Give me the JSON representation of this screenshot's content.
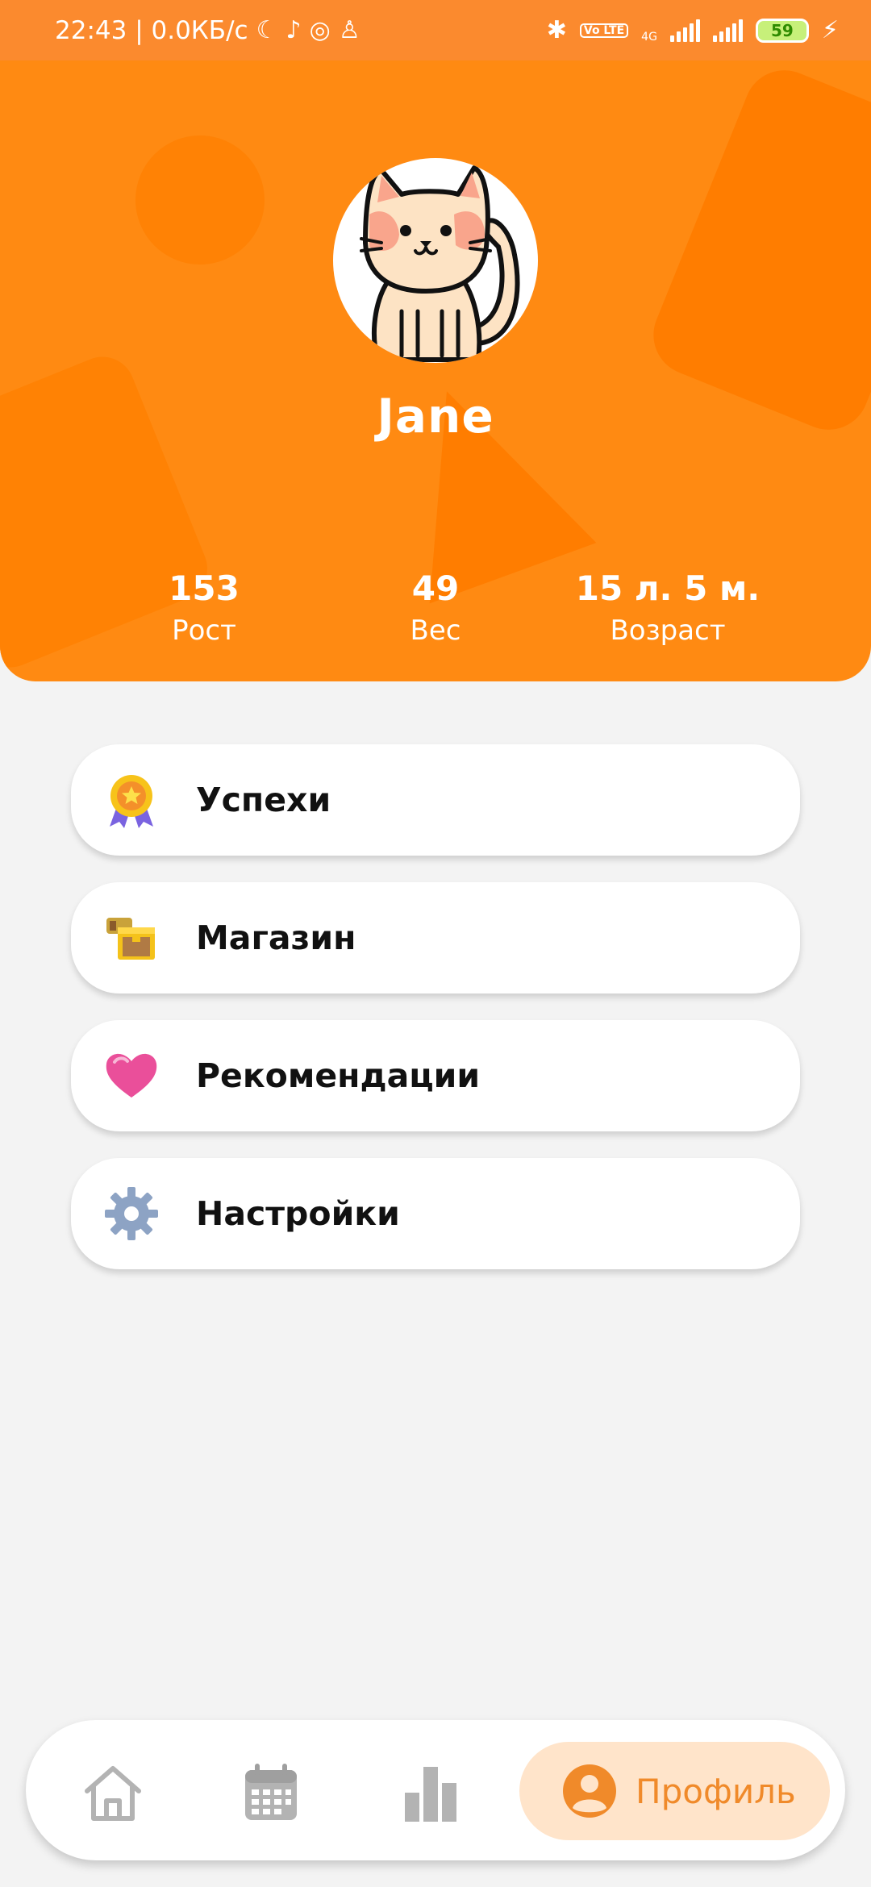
{
  "status_bar": {
    "time_speed": "22:43 | 0.0КБ/с",
    "network_type": "4G",
    "volte": "Vo LTE",
    "battery_level": "59",
    "icons": [
      "moon-icon",
      "tiktok-icon",
      "vpn-icon",
      "qq-icon",
      "bluetooth-icon",
      "volte-icon",
      "signal-icon",
      "signal-icon",
      "battery-icon",
      "charging-icon"
    ]
  },
  "profile": {
    "name": "Jane",
    "avatar": "cat-avatar"
  },
  "stats": [
    {
      "value": "153",
      "label": "Рост"
    },
    {
      "value": "49",
      "label": "Вес"
    },
    {
      "value": "15 л. 5 м.",
      "label": "Возраст"
    }
  ],
  "menu": [
    {
      "label": "Успехи",
      "icon": "medal-icon"
    },
    {
      "label": "Магазин",
      "icon": "treasure-chest-icon"
    },
    {
      "label": "Рекомендации",
      "icon": "heart-icon"
    },
    {
      "label": "Настройки",
      "icon": "gear-icon"
    }
  ],
  "bottom_nav": {
    "items": [
      "home-icon",
      "calendar-icon",
      "stats-bar-icon",
      "profile-icon"
    ],
    "active_label": "Профиль"
  },
  "colors": {
    "accent": "#ff8a12",
    "background": "#f3f3f3",
    "nav_active_bg": "#ffe4ca",
    "nav_active_text": "#f08a2a"
  }
}
